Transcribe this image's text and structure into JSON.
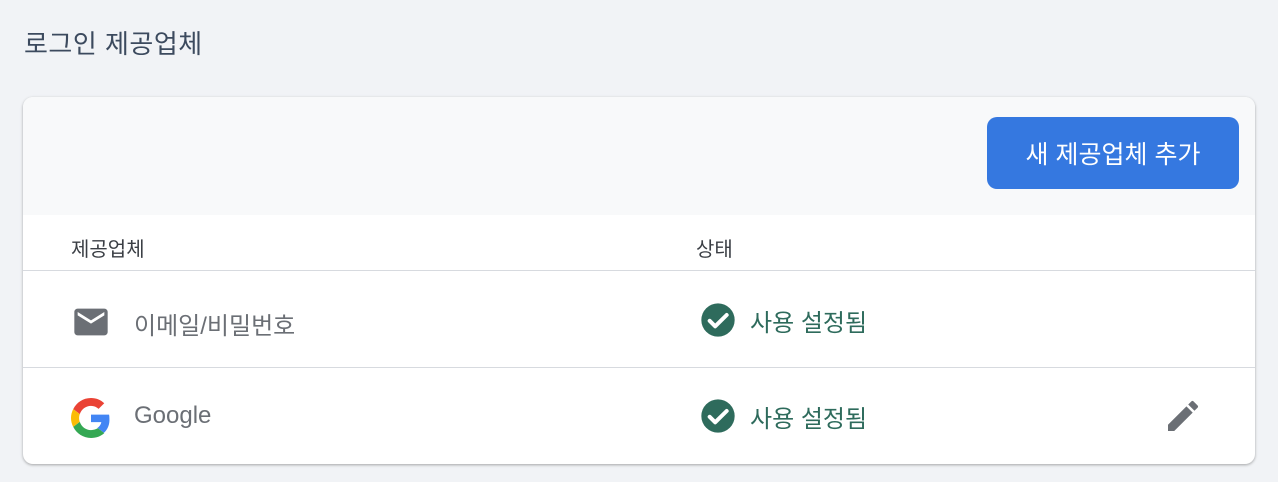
{
  "section": {
    "title": "로그인 제공업체"
  },
  "toolbar": {
    "add_button_label": "새 제공업체 추가"
  },
  "table": {
    "headers": {
      "provider": "제공업체",
      "status": "상태"
    },
    "rows": [
      {
        "provider": "이메일/비밀번호",
        "icon": "email-icon",
        "status": "사용 설정됨",
        "editable": false
      },
      {
        "provider": "Google",
        "icon": "google-icon",
        "status": "사용 설정됨",
        "editable": true
      }
    ]
  },
  "colors": {
    "accent": "#3578e0",
    "status_enabled": "#2e6b5c",
    "background": "#f1f3f6"
  }
}
